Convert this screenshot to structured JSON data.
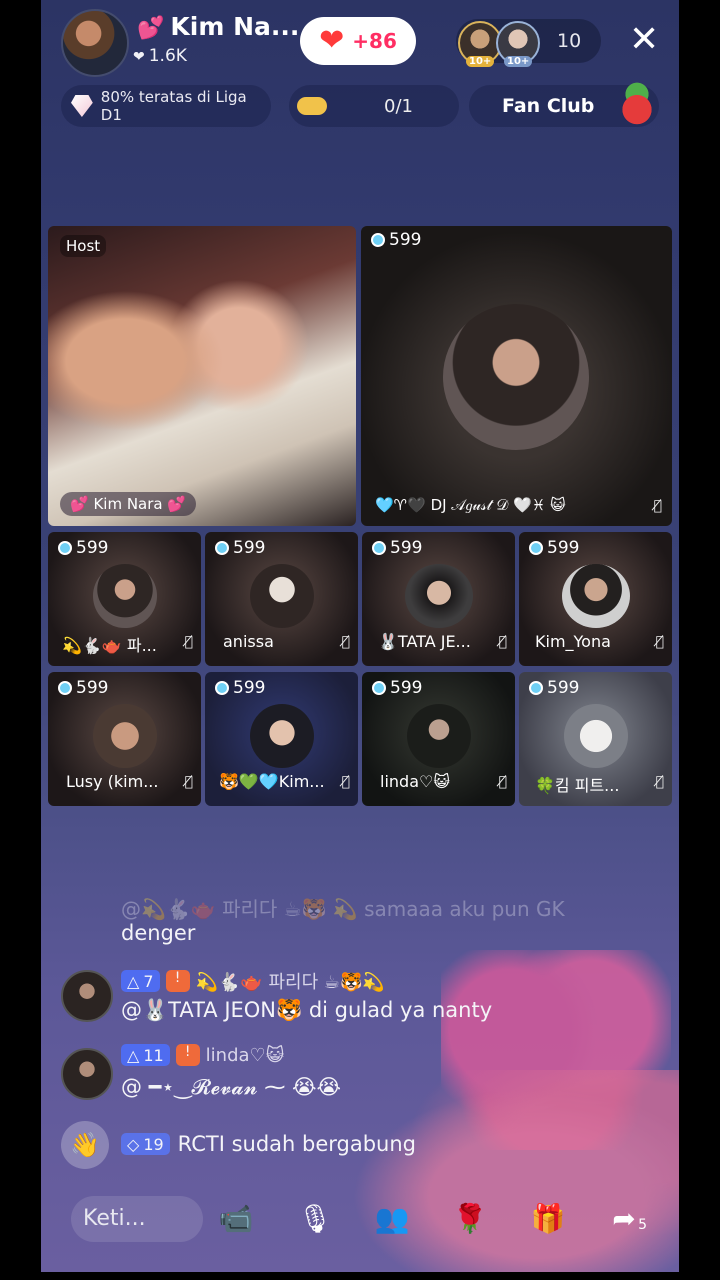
{
  "header": {
    "host_name": "Kim  Na...",
    "likes": "1.6K",
    "follow_count": "+86",
    "viewer_count": "10",
    "viewer_badges": [
      "10+",
      "10+"
    ],
    "rank_text": "80% teratas di Liga D1",
    "task_text": "0/1",
    "fan_club": "Fan Club"
  },
  "host_tile": {
    "tag": "Host",
    "name": "💕 Kim  Nara 💕"
  },
  "featured_tile": {
    "score": "599",
    "name": "🩵♈🖤 DJ 𝒜𝑔𝓊𝓈𝓉 𝒟 🤍♓ 😺"
  },
  "guests": [
    {
      "score": "599",
      "name": "💫🐇🫖 파..."
    },
    {
      "score": "599",
      "name": "anissa"
    },
    {
      "score": "599",
      "name": "🐰TATA JE..."
    },
    {
      "score": "599",
      "name": "Kim_Yona"
    },
    {
      "score": "599",
      "name": "Lusy (kim..."
    },
    {
      "score": "599",
      "name": "🐯💚🩵Kim..."
    },
    {
      "score": "599",
      "name": "linda♡😺"
    },
    {
      "score": "599",
      "name": "🍀킴 피트..."
    }
  ],
  "chat": {
    "faded_line": "@💫🐇🫖 파리다 ☕🐯 💫 samaaa aku pun GK",
    "line0": "denger",
    "msg1": {
      "level": "7",
      "user": "💫🐇🫖 파리다 ☕🐯💫",
      "text": "@🐰TATA JEON🐯 di gulad ya nanty"
    },
    "msg2": {
      "level": "11",
      "user": "linda♡😺",
      "text": "@ ━⋆‿𝓡𝓮𝓿𝓪𝓷 ⁓ 😭😭"
    },
    "join": {
      "level": "19",
      "text": "RCTI sudah bergabung"
    }
  },
  "bottom": {
    "input_placeholder": "Keti...",
    "share_count": "5"
  },
  "icons": [
    "heart-icon",
    "diamond-icon",
    "close-icon",
    "mic-muted-icon",
    "video-off-icon",
    "people-icon",
    "rose-icon",
    "gift-icon",
    "share-icon",
    "wave-icon"
  ]
}
